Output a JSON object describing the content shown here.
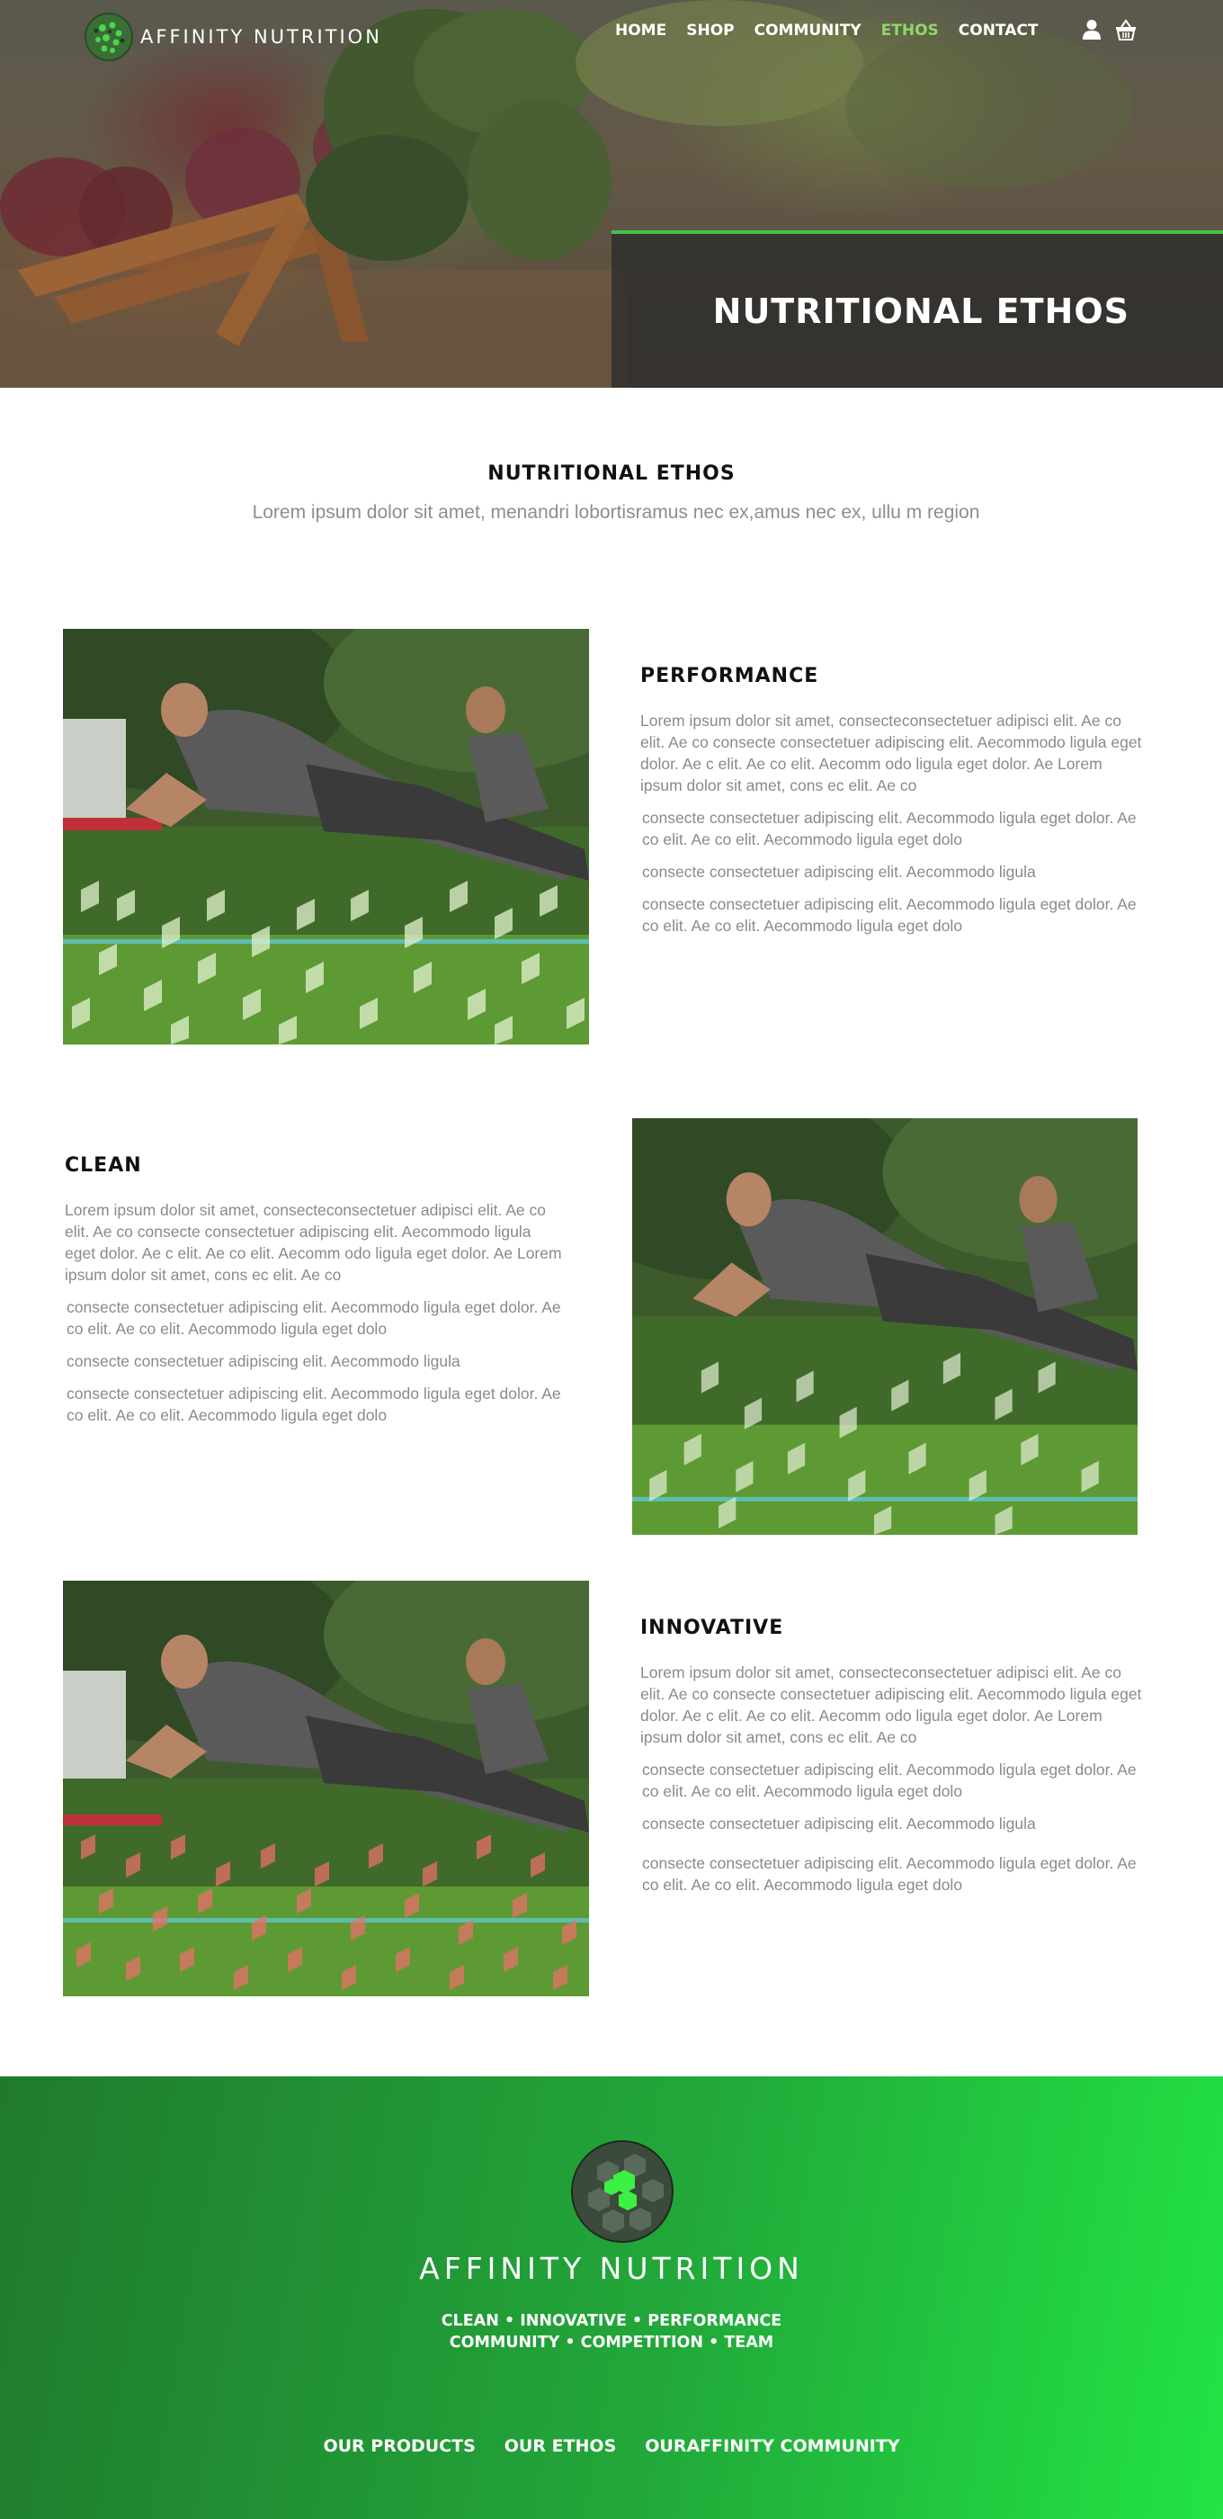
{
  "brand": {
    "name": "AFFINITY NUTRITION",
    "accent": "#47c04a"
  },
  "nav": {
    "items": [
      {
        "label": "HOME",
        "active": false
      },
      {
        "label": "SHOP",
        "active": false
      },
      {
        "label": "COMMUNITY",
        "active": false
      },
      {
        "label": "ETHOS",
        "active": true
      },
      {
        "label": "CONTACT",
        "active": false
      }
    ],
    "icons": [
      "user-icon",
      "basket-icon"
    ]
  },
  "hero": {
    "title": "NUTRITIONAL ETHOS"
  },
  "intro": {
    "title": "NUTRITIONAL ETHOS",
    "text": "Lorem ipsum dolor sit amet, menandri lobortisramus nec ex,amus nec ex, ullu m region"
  },
  "sections": [
    {
      "title": "PERFORMANCE",
      "overlay_color": "#e3f2cf",
      "paragraphs": [
        "Lorem ipsum dolor sit amet, consecteconsectetuer adipisci elit. Ae co elit. Ae co consecte consectetuer adipiscing elit. Aecommodo ligula eget dolor. Ae c elit. Ae co elit. Aecomm odo ligula eget dolor. Ae Lorem ipsum dolor sit amet, cons ec elit. Ae co",
        "consecte consectetuer adipiscing elit. Aecommodo ligula eget dolor. Ae co elit. Ae co elit. Aecommodo ligula eget dolo",
        "consecte consectetuer adipiscing elit. Aecommodo ligula",
        "consecte consectetuer adipiscing elit. Aecommodo ligula eget dolor. Ae co elit. Ae co elit. Aecommodo ligula eget dolo"
      ]
    },
    {
      "title": "CLEAN",
      "overlay_color": "#e3eed6",
      "paragraphs": [
        "Lorem ipsum dolor sit amet, consecteconsectetuer adipisci elit. Ae co elit. Ae co consecte consectetuer adipiscing elit. Aecommodo ligula eget dolor. Ae c elit. Ae co elit. Aecomm odo ligula eget dolor. Ae Lorem ipsum dolor sit amet, cons ec elit. Ae co",
        "consecte consectetuer adipiscing elit. Aecommodo ligula eget dolor. Ae co elit. Ae co elit. Aecommodo ligula eget dolo",
        "consecte consectetuer adipiscing elit. Aecommodo ligula",
        "consecte consectetuer adipiscing elit. Aecommodo ligula eget dolor. Ae co elit. Ae co elit. Aecommodo ligula eget dolo"
      ]
    },
    {
      "title": "INNOVATIVE",
      "overlay_color": "#e8706a",
      "paragraphs": [
        "Lorem ipsum dolor sit amet, consecteconsectetuer adipisci elit. Ae co elit. Ae co consecte consectetuer adipiscing elit. Aecommodo ligula eget dolor. Ae c elit. Ae co elit. Aecomm odo ligula eget dolor. Ae Lorem ipsum dolor sit amet, cons ec elit. Ae co",
        "consecte consectetuer adipiscing elit. Aecommodo ligula eget dolor. Ae co elit. Ae co elit. Aecommodo ligula eget dolo",
        "consecte consectetuer adipiscing elit. Aecommodo ligula",
        "consecte consectetuer adipiscing elit. Aecommodo ligula eget dolor. Ae co elit. Ae co elit. Aecommodo ligula eget dolo"
      ]
    }
  ],
  "footer": {
    "brand": "AFFINITY NUTRITION",
    "tagline_1": "CLEAN • INNOVATIVE • PERFORMANCE",
    "tagline_2": "COMMUNITY • COMPETITION • TEAM",
    "links": [
      "OUR PRODUCTS",
      "OUR ETHOS",
      "OURAFFINITY COMMUNITY"
    ]
  }
}
